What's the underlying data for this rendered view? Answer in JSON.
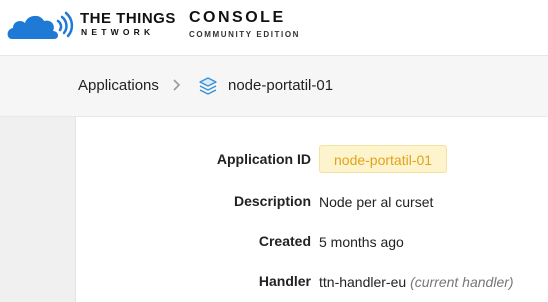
{
  "brand": {
    "name_line1": "THE THINGS",
    "name_line2": "NETWORK",
    "product": "CONSOLE",
    "edition": "COMMUNITY EDITION",
    "colors": {
      "cloud": "#1f7ad6",
      "accent_badge_bg": "#fdf3cd",
      "accent_badge_text": "#e0a41a"
    }
  },
  "breadcrumb": {
    "items": [
      {
        "label": "Applications"
      },
      {
        "label": "node-portatil-01",
        "icon": "layers-icon"
      }
    ],
    "separator_icon": "chevron-right-icon"
  },
  "application": {
    "fields": [
      {
        "label": "Application ID",
        "value": "node-portatil-01"
      },
      {
        "label": "Description",
        "value": "Node per al curset"
      },
      {
        "label": "Created",
        "value": "5 months ago"
      },
      {
        "label": "Handler",
        "value": "ttn-handler-eu",
        "hint": "(current handler)"
      }
    ]
  }
}
